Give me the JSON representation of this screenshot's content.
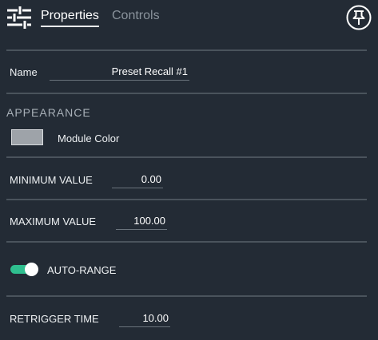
{
  "header": {
    "tabs": [
      {
        "label": "Properties",
        "active": true
      },
      {
        "label": "Controls",
        "active": false
      }
    ],
    "icons": {
      "left": "sliders-icon",
      "right": "pin-icon"
    }
  },
  "name_field": {
    "label": "Name",
    "value": "Preset Recall #1"
  },
  "appearance": {
    "title": "APPEARANCE",
    "module_color_label": "Module Color",
    "module_color": "#9ea3a9"
  },
  "minimum_value": {
    "label": "MINIMUM VALUE",
    "value": "0.00"
  },
  "maximum_value": {
    "label": "MAXIMUM VALUE",
    "value": "100.00"
  },
  "auto_range": {
    "label": "AUTO-RANGE",
    "on": true,
    "color": "#2fbf8f"
  },
  "retrigger_time": {
    "label": "RETRIGGER TIME",
    "value": "10.00"
  }
}
